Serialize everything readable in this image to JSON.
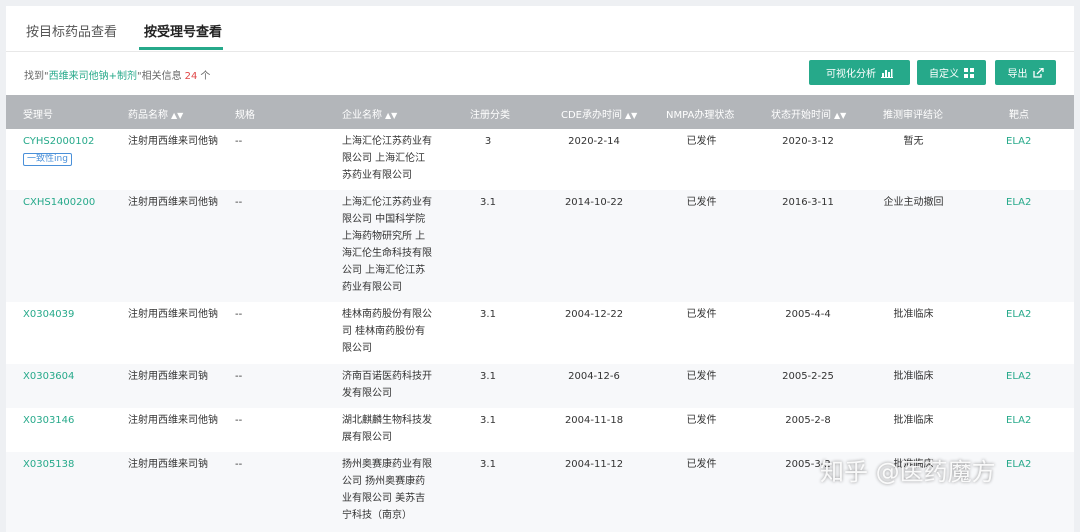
{
  "tabs": [
    {
      "label": "按目标药品查看",
      "active": false
    },
    {
      "label": "按受理号查看",
      "active": true
    }
  ],
  "info": {
    "prefix": "找到\"",
    "query": "西维来司他钠+制剂",
    "middle": "\"相关信息",
    "count": "24",
    "suffix": "个"
  },
  "toolbar": {
    "visual_label": "可视化分析",
    "custom_label": "自定义",
    "export_label": "导出"
  },
  "columns": {
    "no": "受理号",
    "name": "药品名称",
    "spec": "规格",
    "company": "企业名称",
    "reg_class": "注册分类",
    "cde_date": "CDE承办时间",
    "nmpa_status": "NMPA办理状态",
    "status_date": "状态开始时间",
    "conclusion": "推测审评结论",
    "target": "靶点"
  },
  "rows": [
    {
      "no": "CYHS2000102",
      "tag": "一致性ing",
      "name": "注射用西维来司他钠",
      "spec": "--",
      "company": "上海汇伦江苏药业有限公司 上海汇伦江苏药业有限公司",
      "reg_class": "3",
      "cde_date": "2020-2-14",
      "nmpa_status": "已发件",
      "status_date": "2020-3-12",
      "conclusion": "暂无",
      "target": "ELA2"
    },
    {
      "no": "CXHS1400200",
      "name": "注射用西维来司他钠",
      "spec": "--",
      "company": "上海汇伦江苏药业有限公司 中国科学院上海药物研究所 上海汇伦生命科技有限公司 上海汇伦江苏药业有限公司",
      "reg_class": "3.1",
      "cde_date": "2014-10-22",
      "nmpa_status": "已发件",
      "status_date": "2016-3-11",
      "conclusion": "企业主动撤回",
      "target": "ELA2"
    },
    {
      "no": "X0304039",
      "name": "注射用西维来司他钠",
      "spec": "--",
      "company": "桂林南药股份有限公司 桂林南药股份有限公司",
      "reg_class": "3.1",
      "cde_date": "2004-12-22",
      "nmpa_status": "已发件",
      "status_date": "2005-4-4",
      "conclusion": "批准临床",
      "target": "ELA2"
    },
    {
      "no": "X0303604",
      "name": "注射用西维来司钠",
      "spec": "--",
      "company": "济南百诺医药科技开发有限公司",
      "reg_class": "3.1",
      "cde_date": "2004-12-6",
      "nmpa_status": "已发件",
      "status_date": "2005-2-25",
      "conclusion": "批准临床",
      "target": "ELA2"
    },
    {
      "no": "X0303146",
      "name": "注射用西维来司他钠",
      "spec": "--",
      "company": "湖北麒麟生物科技发展有限公司",
      "reg_class": "3.1",
      "cde_date": "2004-11-18",
      "nmpa_status": "已发件",
      "status_date": "2005-2-8",
      "conclusion": "批准临床",
      "target": "ELA2"
    },
    {
      "no": "X0305138",
      "name": "注射用西维来司钠",
      "spec": "--",
      "company": "扬州奥赛康药业有限公司 扬州奥赛康药业有限公司 美苏吉宁科技（南京）",
      "reg_class": "3.1",
      "cde_date": "2004-11-12",
      "nmpa_status": "已发件",
      "status_date": "2005-3-2",
      "conclusion": "批准临床",
      "target": "ELA2"
    }
  ],
  "watermark": "知乎 @医药魔方",
  "colors": {
    "accent": "#26a98a",
    "header_bg": "#b3b6ba",
    "count": "#e04747",
    "tag": "#4a90d9"
  }
}
